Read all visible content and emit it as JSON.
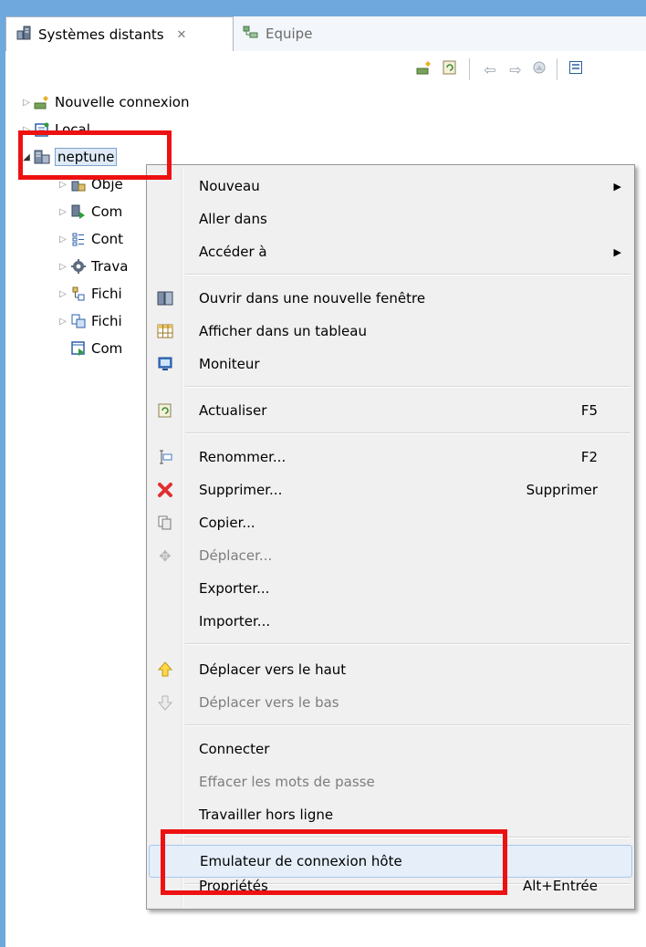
{
  "tabs": [
    {
      "label": "Systèmes distants",
      "active": true,
      "icon": "remote-systems-icon"
    },
    {
      "label": "Equipe",
      "active": false,
      "icon": "team-icon"
    }
  ],
  "tree": {
    "new_connection": "Nouvelle connexion",
    "local": "Local",
    "neptune": "neptune",
    "children": [
      "Obje",
      "Com",
      "Cont",
      "Trava",
      "Fichi",
      "Fichi",
      "Com"
    ]
  },
  "menu": {
    "new": "Nouveau",
    "go_into": "Aller dans",
    "go_to": "Accéder à",
    "open_new_window": "Ouvrir dans une nouvelle fenêtre",
    "show_in_table": "Afficher dans un tableau",
    "monitor": "Moniteur",
    "refresh": "Actualiser",
    "refresh_shortcut": "F5",
    "rename": "Renommer...",
    "rename_shortcut": "F2",
    "delete": "Supprimer...",
    "delete_shortcut": "Supprimer",
    "copy": "Copier...",
    "move": "Déplacer...",
    "export": "Exporter...",
    "import": "Importer...",
    "move_up": "Déplacer vers le haut",
    "move_down": "Déplacer vers le bas",
    "connect": "Connecter",
    "clear_passwords": "Effacer les mots de passe",
    "work_offline": "Travailler hors ligne",
    "host_emulator": "Emulateur de connexion hôte",
    "properties": "Propriétés",
    "properties_shortcut": "Alt+Entrée"
  },
  "colors": {
    "highlight": "#ee1111",
    "accent": "#6fa8dc"
  }
}
